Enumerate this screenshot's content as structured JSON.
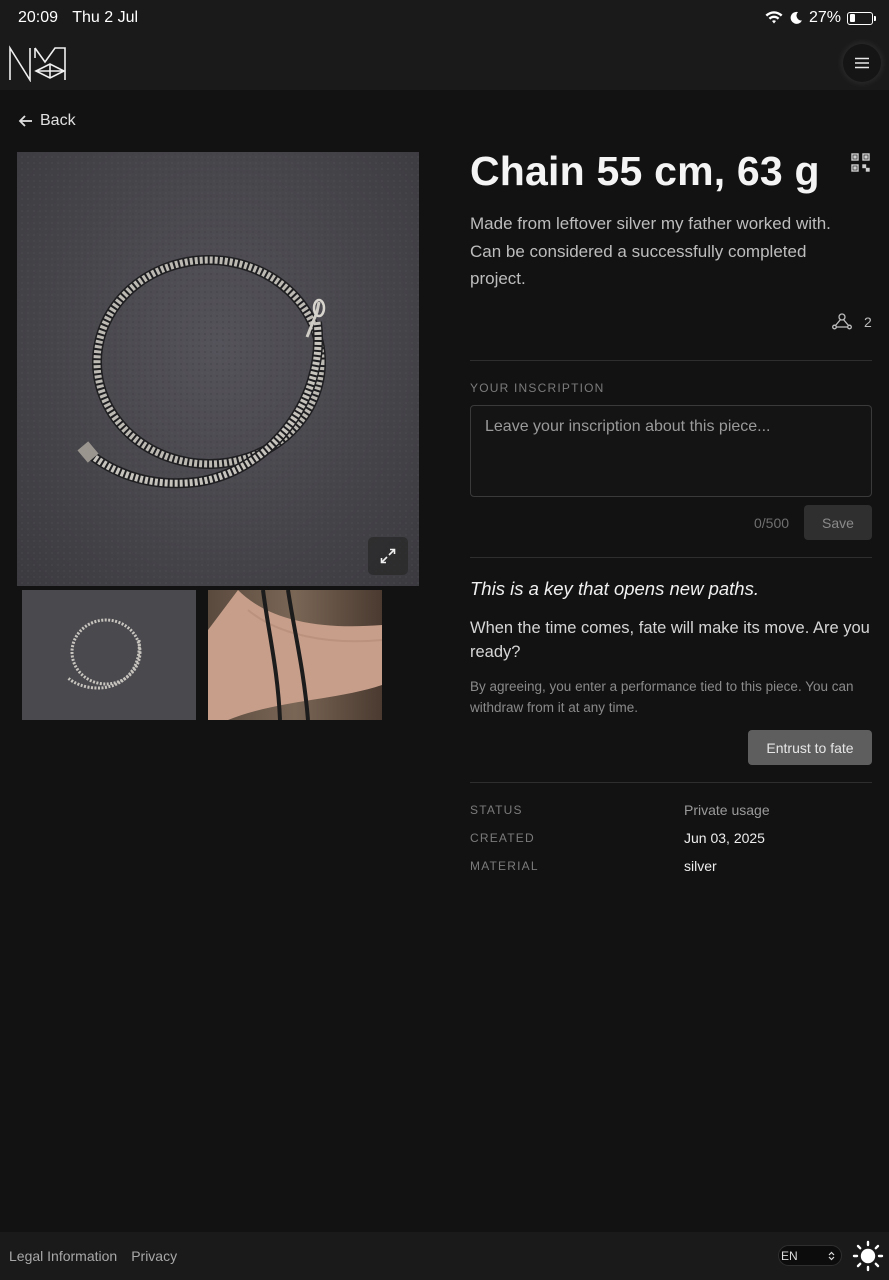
{
  "status_bar": {
    "time": "20:09",
    "date": "Thu 2 Jul",
    "battery": "27%",
    "battery_level": 0.27
  },
  "header": {
    "logo_alt": "NM",
    "menu_icon": "hamburger-menu-icon"
  },
  "nav": {
    "back_label": "Back"
  },
  "item": {
    "title": "Chain 55 cm, 63 g",
    "description": "Made from leftover silver my father worked with. Can be considered a successfully completed project.",
    "owner_count": "2"
  },
  "inscription": {
    "label": "YOUR INSCRIPTION",
    "placeholder": "Leave your inscription about this piece...",
    "counter": "0/500",
    "save_label": "Save"
  },
  "fate": {
    "key_text": "This is a key that opens new paths.",
    "fate_text": "When the time comes, fate will make its move. Are you ready?",
    "agree_text": "By agreeing, you enter a performance tied to this piece. You can withdraw from it at any time.",
    "entrust_label": "Entrust to fate"
  },
  "meta": {
    "status_label": "STATUS",
    "status_value": "Private usage",
    "created_label": "CREATED",
    "created_value": "Jun 03, 2025",
    "material_label": "MATERIAL",
    "material_value": "silver"
  },
  "footer": {
    "legal_label": "Legal Information",
    "privacy_label": "Privacy",
    "language": "EN"
  },
  "colors": {
    "background": "#121212",
    "bar": "#1a1a1a",
    "entrust_button": "#5e5e5e"
  }
}
